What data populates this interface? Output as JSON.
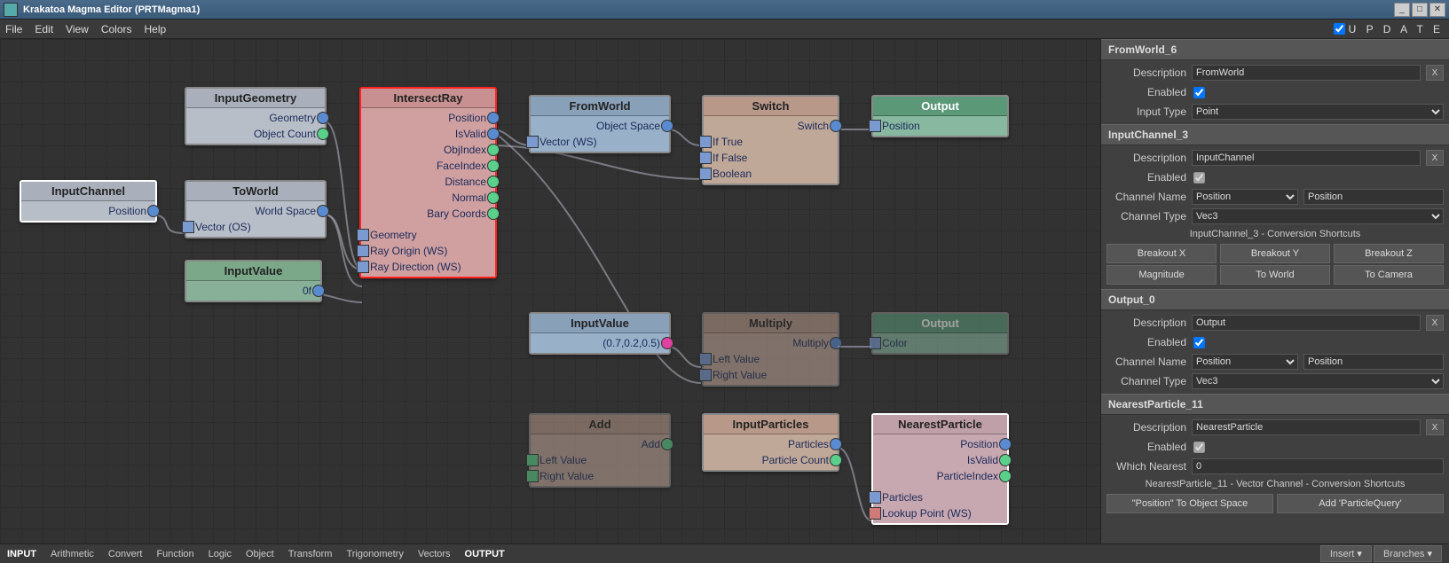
{
  "window": {
    "title": "Krakatoa Magma Editor (PRTMagma1)"
  },
  "menu": [
    "File",
    "Edit",
    "View",
    "Colors",
    "Help"
  ],
  "update": {
    "label": "U P D A T E",
    "checked": true
  },
  "statusbar": {
    "cats": [
      "INPUT",
      "Arithmetic",
      "Convert",
      "Function",
      "Logic",
      "Object",
      "Transform",
      "Trigonometry",
      "Vectors",
      "OUTPUT"
    ],
    "right": [
      "Insert",
      "Branches"
    ]
  },
  "nodes": {
    "inputChannel": {
      "title": "InputChannel",
      "outs": [
        {
          "l": "Position",
          "c": "blue"
        }
      ]
    },
    "inputGeometry": {
      "title": "InputGeometry",
      "outs": [
        {
          "l": "Geometry",
          "c": "blue"
        },
        {
          "l": "Object Count",
          "c": "green"
        }
      ]
    },
    "toWorld": {
      "title": "ToWorld",
      "outs": [
        {
          "l": "World Space",
          "c": "blue"
        }
      ],
      "ins": [
        {
          "l": "Vector (OS)"
        }
      ]
    },
    "inputValue1": {
      "title": "InputValue",
      "outs": [
        {
          "l": "0f",
          "c": "blue"
        }
      ]
    },
    "intersectRay": {
      "title": "IntersectRay",
      "outs": [
        {
          "l": "Position",
          "c": "blue"
        },
        {
          "l": "IsValid",
          "c": "blue"
        },
        {
          "l": "ObjIndex",
          "c": "green"
        },
        {
          "l": "FaceIndex",
          "c": "green"
        },
        {
          "l": "Distance",
          "c": "green"
        },
        {
          "l": "Normal",
          "c": "green"
        },
        {
          "l": "Bary Coords",
          "c": "green"
        }
      ],
      "ins": [
        {
          "l": "Geometry"
        },
        {
          "l": "Ray Origin (WS)"
        },
        {
          "l": "Ray Direction (WS)"
        }
      ]
    },
    "fromWorld": {
      "title": "FromWorld",
      "outs": [
        {
          "l": "Object Space",
          "c": "blue"
        }
      ],
      "ins": [
        {
          "l": "Vector (WS)"
        }
      ]
    },
    "switch": {
      "title": "Switch",
      "outs": [
        {
          "l": "Switch",
          "c": "blue"
        }
      ],
      "ins": [
        {
          "l": "If True"
        },
        {
          "l": "If False"
        },
        {
          "l": "Boolean"
        }
      ]
    },
    "output1": {
      "title": "Output",
      "ins": [
        {
          "l": "Position"
        }
      ]
    },
    "inputValue2": {
      "title": "InputValue",
      "outs": [
        {
          "l": "(0.7,0.2,0.5)",
          "c": "pink"
        }
      ]
    },
    "multiply": {
      "title": "Multiply",
      "outs": [
        {
          "l": "Multiply",
          "c": "blue"
        }
      ],
      "ins": [
        {
          "l": "Left Value"
        },
        {
          "l": "Right Value"
        }
      ]
    },
    "output2": {
      "title": "Output",
      "ins": [
        {
          "l": "Color"
        }
      ]
    },
    "add": {
      "title": "Add",
      "outs": [
        {
          "l": "Add",
          "c": "green"
        }
      ],
      "ins": [
        {
          "l": "Left Value"
        },
        {
          "l": "Right Value"
        }
      ]
    },
    "inputParticles": {
      "title": "InputParticles",
      "outs": [
        {
          "l": "Particles",
          "c": "blue"
        },
        {
          "l": "Particle Count",
          "c": "green"
        }
      ]
    },
    "nearestParticle": {
      "title": "NearestParticle",
      "outs": [
        {
          "l": "Position",
          "c": "blue"
        },
        {
          "l": "IsValid",
          "c": "green"
        },
        {
          "l": "ParticleIndex",
          "c": "green"
        }
      ],
      "ins": [
        {
          "l": "Particles"
        },
        {
          "l": "Lookup Point (WS)",
          "red": true
        }
      ]
    }
  },
  "panels": {
    "fromWorld": {
      "hdr": "FromWorld_6",
      "desc": "FromWorld",
      "enabled": true,
      "inputType": "Point"
    },
    "inputChannel": {
      "hdr": "InputChannel_3",
      "desc": "InputChannel",
      "enabled": true,
      "channelName": "Position",
      "channelNameR": "Position",
      "channelType": "Vec3",
      "shortcuts": "InputChannel_3 - Conversion Shortcuts",
      "btns1": [
        "Breakout X",
        "Breakout Y",
        "Breakout Z"
      ],
      "btns2": [
        "Magnitude",
        "To World",
        "To Camera"
      ]
    },
    "output": {
      "hdr": "Output_0",
      "desc": "Output",
      "enabled": true,
      "channelName": "Position",
      "channelNameR": "Position",
      "channelType": "Vec3"
    },
    "nearest": {
      "hdr": "NearestParticle_11",
      "desc": "NearestParticle",
      "enabled": true,
      "whichNearest": "0",
      "shortcuts": "NearestParticle_11 - Vector Channel - Conversion Shortcuts",
      "btns": [
        "\"Position\" To Object Space",
        "Add 'ParticleQuery'"
      ]
    }
  },
  "labels": {
    "description": "Description",
    "enabled": "Enabled",
    "inputType": "Input Type",
    "channelName": "Channel Name",
    "channelType": "Channel Type",
    "whichNearest": "Which Nearest"
  }
}
